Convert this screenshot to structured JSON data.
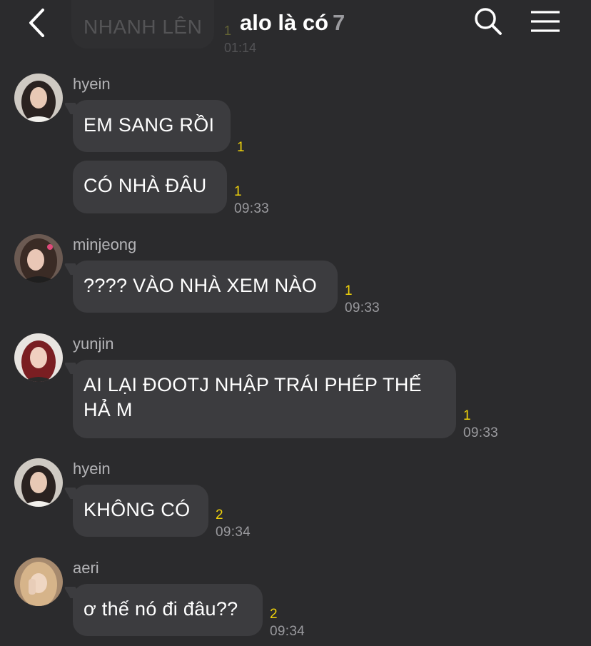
{
  "header": {
    "title": "alo là có",
    "member_count": "7",
    "pinned_preview": {
      "text": "NHANH LÊN",
      "unread": "1",
      "time": "01:14"
    }
  },
  "messages": [
    {
      "sender": "hyein",
      "text": "EM SANG RỒI",
      "unread": "1",
      "time": ""
    },
    {
      "sender": "",
      "text": "CÓ NHÀ ĐÂU",
      "unread": "1",
      "time": "09:33"
    },
    {
      "sender": "minjeong",
      "text": "???? VÀO NHÀ XEM NÀO",
      "unread": "1",
      "time": "09:33"
    },
    {
      "sender": "yunjin",
      "text": "AI LẠI ĐOOTJ NHẬP TRÁI PHÉP THẾ HẢ M",
      "unread": "1",
      "time": "09:33"
    },
    {
      "sender": "hyein",
      "text": "KHÔNG CÓ",
      "unread": "2",
      "time": "09:34"
    },
    {
      "sender": "aeri",
      "text": "ơ thế nó đi đâu??",
      "unread": "2",
      "time": "09:34"
    }
  ],
  "icons": {
    "back": "chevron-left-icon",
    "search": "search-icon",
    "menu": "hamburger-menu-icon"
  },
  "colors": {
    "background": "#2b2b2d",
    "bubble": "#3c3c3f",
    "unread_count": "#f1d30b",
    "time": "#9a9a9e"
  }
}
